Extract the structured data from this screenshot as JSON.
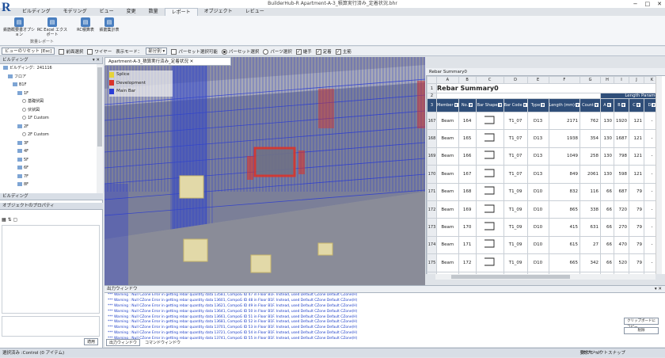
{
  "app": {
    "title": "BuilderHub-R Apartment-A-3_積算実行済み_定着状況.bhr",
    "logo": "R"
  },
  "ribbon_tabs": [
    "ビルディング",
    "モデリング",
    "ビュー",
    "変更",
    "数量",
    "レポート",
    "オブジェクト",
    "レビュー"
  ],
  "ribbon_buttons": [
    "鉄筋概要書オプション",
    "RC Excel エクスポート",
    "RC積算表",
    "鉄筋集計表"
  ],
  "ribbon_group": "数量レポート",
  "options": {
    "reset": "ビューのリセット [Esc]",
    "front": "前面選択",
    "wire": "ワイヤー",
    "mode_label": "表示モード：",
    "mode_value": "部分別",
    "parcel": "パーセット選択可能",
    "radio1": "パーセット選択",
    "radio2": "パーツ選択",
    "c1": "継手",
    "c2": "定着",
    "c3": "主筋"
  },
  "left": {
    "head": "ビルディング",
    "props_head": "オブジェクトのプロパティ",
    "apply": "適用",
    "tree": [
      "ビルディング：241116",
      "フロア",
      "B1F",
      "1F",
      "基礎伏図",
      "伏状図",
      "1F Custom",
      "2F",
      "2F Custom",
      "3F",
      "4F",
      "5F",
      "6F",
      "7F",
      "8F"
    ]
  },
  "viewport": {
    "tab": "Apartment-A-3_積算実行済み_定着状況",
    "legend": [
      {
        "label": "Splice",
        "color": "#e6d43a"
      },
      {
        "label": "Development",
        "color": "#d9342b"
      },
      {
        "label": "Main Bar",
        "color": "#2b3dd6"
      }
    ]
  },
  "sheet": {
    "title": "Rebar Summary0",
    "heading": "Rebar Summary0",
    "param": "Length Paramet",
    "cols": [
      "A",
      "B",
      "C",
      "D",
      "E",
      "F",
      "G",
      "H",
      "I",
      "J",
      "K"
    ],
    "headers": [
      "Member",
      "No.",
      "Bar Shape",
      "Bar Code",
      "Type",
      "Length (mm)",
      "Count",
      "A",
      "B",
      "C",
      "D"
    ],
    "rows": [
      {
        "r": "167",
        "m": "Beam",
        "no": "164",
        "code": "T1_07",
        "type": "D13",
        "len": "2171",
        "cnt": "762",
        "a": "130",
        "b": "1920",
        "c": "121",
        "d": "-"
      },
      {
        "r": "168",
        "m": "Beam",
        "no": "165",
        "code": "T1_07",
        "type": "D13",
        "len": "1938",
        "cnt": "354",
        "a": "130",
        "b": "1687",
        "c": "121",
        "d": "-"
      },
      {
        "r": "169",
        "m": "Beam",
        "no": "166",
        "code": "T1_07",
        "type": "D13",
        "len": "1049",
        "cnt": "258",
        "a": "130",
        "b": "798",
        "c": "121",
        "d": "-"
      },
      {
        "r": "170",
        "m": "Beam",
        "no": "167",
        "code": "T1_07",
        "type": "D13",
        "len": "849",
        "cnt": "2061",
        "a": "130",
        "b": "598",
        "c": "121",
        "d": "-"
      },
      {
        "r": "171",
        "m": "Beam",
        "no": "168",
        "code": "T1_09",
        "type": "D10",
        "len": "832",
        "cnt": "116",
        "a": "66",
        "b": "687",
        "c": "79",
        "d": "-"
      },
      {
        "r": "172",
        "m": "Beam",
        "no": "169",
        "code": "T1_09",
        "type": "D10",
        "len": "865",
        "cnt": "338",
        "a": "66",
        "b": "720",
        "c": "79",
        "d": "-"
      },
      {
        "r": "173",
        "m": "Beam",
        "no": "170",
        "code": "T1_09",
        "type": "D10",
        "len": "415",
        "cnt": "631",
        "a": "66",
        "b": "270",
        "c": "79",
        "d": "-"
      },
      {
        "r": "174",
        "m": "Beam",
        "no": "171",
        "code": "T1_09",
        "type": "D10",
        "len": "615",
        "cnt": "27",
        "a": "66",
        "b": "470",
        "c": "79",
        "d": "-"
      },
      {
        "r": "175",
        "m": "Beam",
        "no": "172",
        "code": "T1_09",
        "type": "D10",
        "len": "665",
        "cnt": "342",
        "a": "66",
        "b": "520",
        "c": "79",
        "d": "-"
      },
      {
        "r": "176",
        "m": "Beam",
        "no": "173",
        "code": "T1_09",
        "type": "D10",
        "len": "632",
        "cnt": "48",
        "a": "66",
        "b": "487",
        "c": "79",
        "d": "-"
      }
    ]
  },
  "output": {
    "head": "出力ウィンドウ",
    "lines": [
      "*** Warning : Null CZone Error in getting rebar quantity data 13581, CompoG ID 47 in Floor B1F. Instead, used Default CZone Default CZone(H)",
      "*** Warning : Null CZone Error in getting rebar quantity data 13601, CompoG ID 48 in Floor B1F. Instead, used Default CZone Default CZone(H)",
      "*** Warning : Null CZone Error in getting rebar quantity data 13621, CompoG ID 49 in Floor B1F. Instead, used Default CZone Default CZone(H)",
      "*** Warning : Null CZone Error in getting rebar quantity data 13641, CompoG ID 50 in Floor B1F. Instead, used Default CZone Default CZone(H)",
      "*** Warning : Null CZone Error in getting rebar quantity data 13661, CompoG ID 51 in Floor B1F. Instead, used Default CZone Default CZone(H)",
      "*** Warning : Null CZone Error in getting rebar quantity data 13681, CompoG ID 52 in Floor B1F. Instead, used Default CZone Default CZone(H)",
      "*** Warning : Null CZone Error in getting rebar quantity data 13701, CompoG ID 53 in Floor B1F. Instead, used Default CZone Default CZone(H)",
      "*** Warning : Null CZone Error in getting rebar quantity data 13721, CompoG ID 54 in Floor B1F. Instead, used Default CZone Default CZone(H)",
      "*** Warning : Null CZone Error in getting rebar quantity data 13741, CompoG ID 55 in Floor B1F. Instead, used Default CZone Default CZone(H)"
    ],
    "copy": "クリップボードにコピー",
    "clear": "削除",
    "tab1": "出力ウィンドウ",
    "tab2": "コマンドウィンドウ"
  },
  "status": {
    "text": "選択済み :Control (0 アイテム)",
    "snap1": "要求モード",
    "snap2": "オブジェクトスナップ"
  }
}
